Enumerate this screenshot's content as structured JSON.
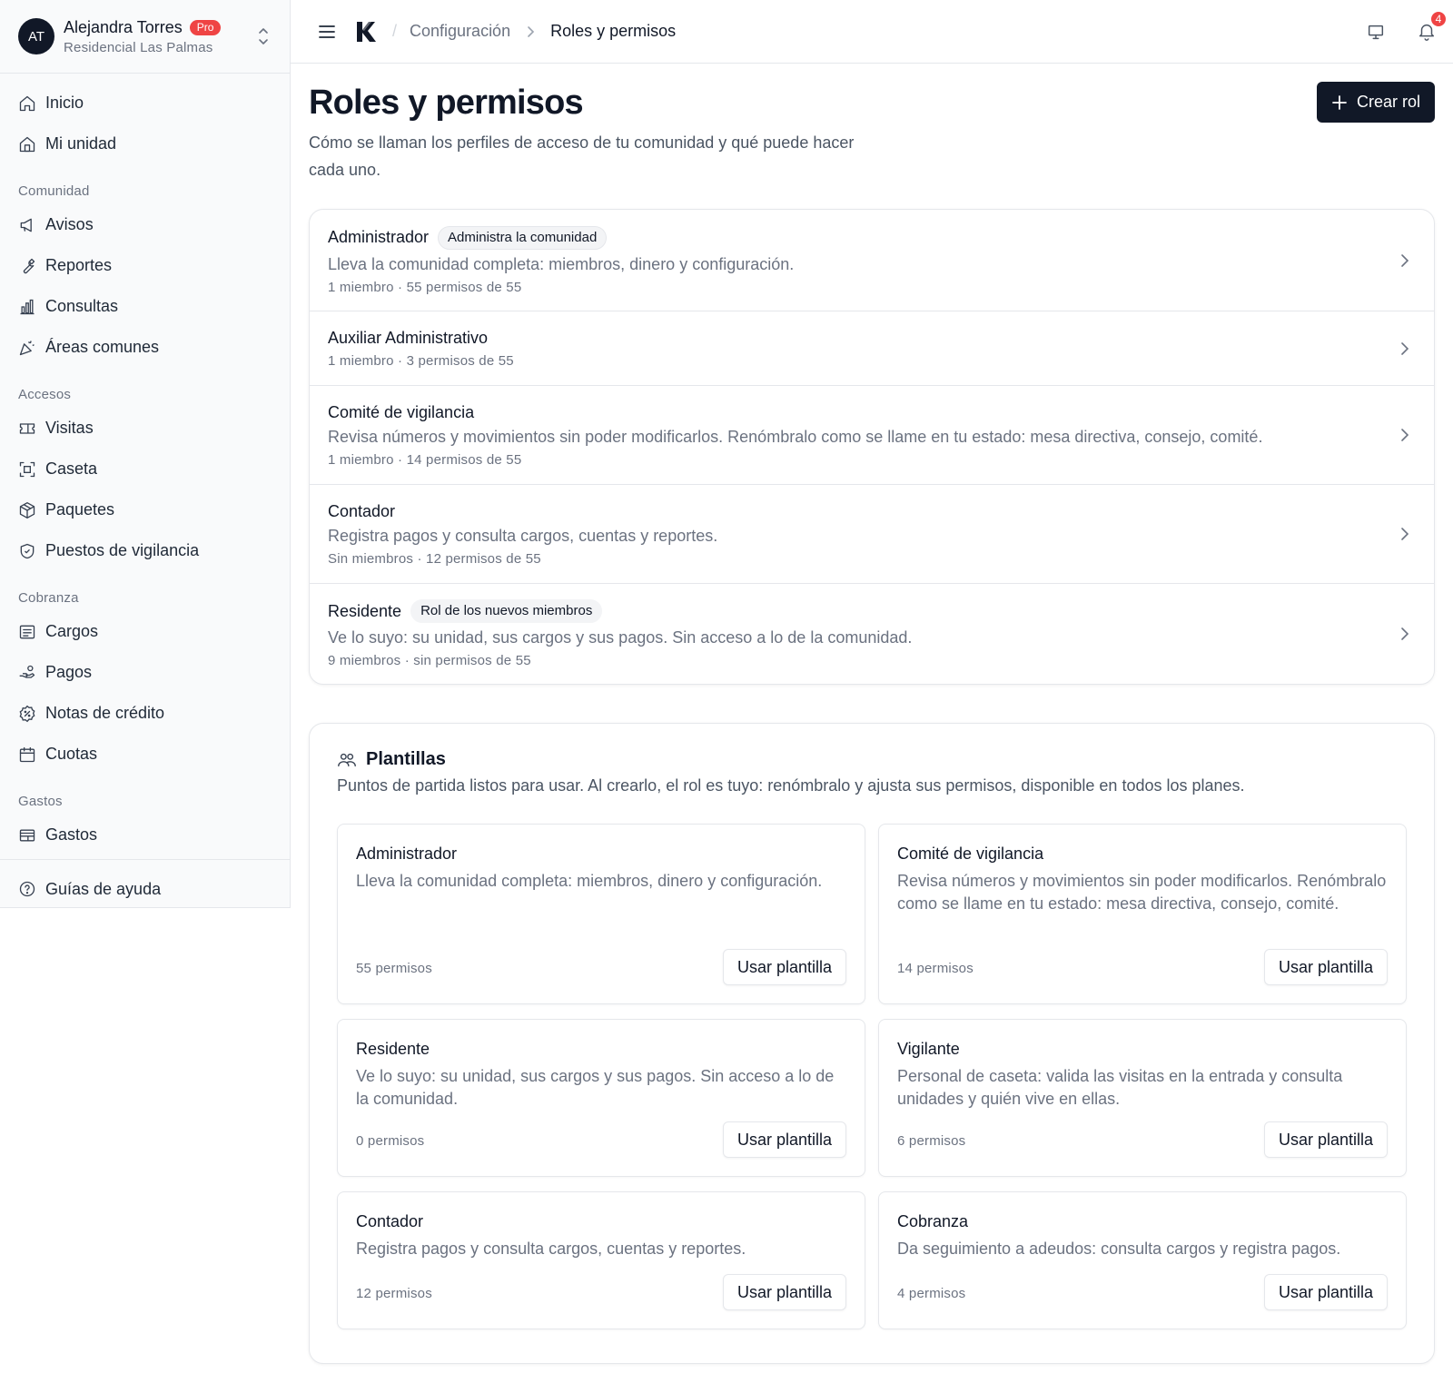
{
  "user": {
    "initials": "AT",
    "name": "Alejandra Torres",
    "plan_badge": "Pro",
    "community": "Residencial Las Palmas"
  },
  "sidebar": {
    "top_items": [
      {
        "label": "Inicio",
        "icon": "home-icon"
      },
      {
        "label": "Mi unidad",
        "icon": "unit-icon"
      }
    ],
    "sections": [
      {
        "title": "Comunidad",
        "items": [
          {
            "label": "Avisos",
            "icon": "megaphone-icon"
          },
          {
            "label": "Reportes",
            "icon": "wrench-icon"
          },
          {
            "label": "Consultas",
            "icon": "bar-chart-icon"
          },
          {
            "label": "Áreas comunes",
            "icon": "party-icon"
          }
        ]
      },
      {
        "title": "Accesos",
        "items": [
          {
            "label": "Visitas",
            "icon": "ticket-icon"
          },
          {
            "label": "Caseta",
            "icon": "scan-icon"
          },
          {
            "label": "Paquetes",
            "icon": "package-icon"
          },
          {
            "label": "Puestos de vigilancia",
            "icon": "shield-icon"
          }
        ]
      },
      {
        "title": "Cobranza",
        "items": [
          {
            "label": "Cargos",
            "icon": "receipt-icon"
          },
          {
            "label": "Pagos",
            "icon": "hand-coins-icon"
          },
          {
            "label": "Notas de crédito",
            "icon": "badge-percent-icon"
          },
          {
            "label": "Cuotas",
            "icon": "calendar-icon"
          }
        ]
      },
      {
        "title": "Gastos",
        "items": [
          {
            "label": "Gastos",
            "icon": "wallet-icon"
          }
        ]
      }
    ],
    "help_label": "Guías de ayuda"
  },
  "topbar": {
    "breadcrumb_parent": "Configuración",
    "breadcrumb_current": "Roles y permisos",
    "notification_count": "4"
  },
  "page": {
    "title": "Roles y permisos",
    "description": "Cómo se llaman los perfiles de acceso de tu comunidad y qué puede hacer cada uno.",
    "create_button": "Crear rol"
  },
  "roles": [
    {
      "name": "Administrador",
      "tag": "Administra la comunidad",
      "description": "Lleva la comunidad completa: miembros, dinero y configuración.",
      "meta": "1 miembro · 55 permisos de 55"
    },
    {
      "name": "Auxiliar Administrativo",
      "tag": "",
      "description": "",
      "meta": "1 miembro · 3 permisos de 55"
    },
    {
      "name": "Comité de vigilancia",
      "tag": "",
      "description": "Revisa números y movimientos sin poder modificarlos. Renómbralo como se llame en tu estado: mesa directiva, consejo, comité.",
      "meta": "1 miembro · 14 permisos de 55"
    },
    {
      "name": "Contador",
      "tag": "",
      "description": "Registra pagos y consulta cargos, cuentas y reportes.",
      "meta": "Sin miembros · 12 permisos de 55"
    },
    {
      "name": "Residente",
      "tag": "Rol de los nuevos miembros",
      "description": "Ve lo suyo: su unidad, sus cargos y sus pagos. Sin acceso a lo de la comunidad.",
      "meta": "9 miembros · sin permisos de 55"
    }
  ],
  "templates": {
    "title": "Plantillas",
    "description": "Puntos de partida listos para usar. Al crearlo, el rol es tuyo: renómbralo y ajusta sus permisos, disponible en todos los planes.",
    "button_label": "Usar plantilla",
    "items": [
      {
        "name": "Administrador",
        "description": "Lleva la comunidad completa: miembros, dinero y configuración.",
        "count": "55 permisos"
      },
      {
        "name": "Comité de vigilancia",
        "description": "Revisa números y movimientos sin poder modificarlos. Renómbralo como se llame en tu estado: mesa directiva, consejo, comité.",
        "count": "14 permisos"
      },
      {
        "name": "Residente",
        "description": "Ve lo suyo: su unidad, sus cargos y sus pagos. Sin acceso a lo de la comunidad.",
        "count": "0 permisos"
      },
      {
        "name": "Vigilante",
        "description": "Personal de caseta: valida las visitas en la entrada y consulta unidades y quién vive en ellas.",
        "count": "6 permisos"
      },
      {
        "name": "Contador",
        "description": "Registra pagos y consulta cargos, cuentas y reportes.",
        "count": "12 permisos"
      },
      {
        "name": "Cobranza",
        "description": "Da seguimiento a adeudos: consulta cargos y registra pagos.",
        "count": "4 permisos"
      }
    ]
  },
  "colors": {
    "primary": "#111827",
    "badge_red": "#ef4444",
    "muted_text": "#6b7280",
    "border": "#e5e7eb"
  }
}
